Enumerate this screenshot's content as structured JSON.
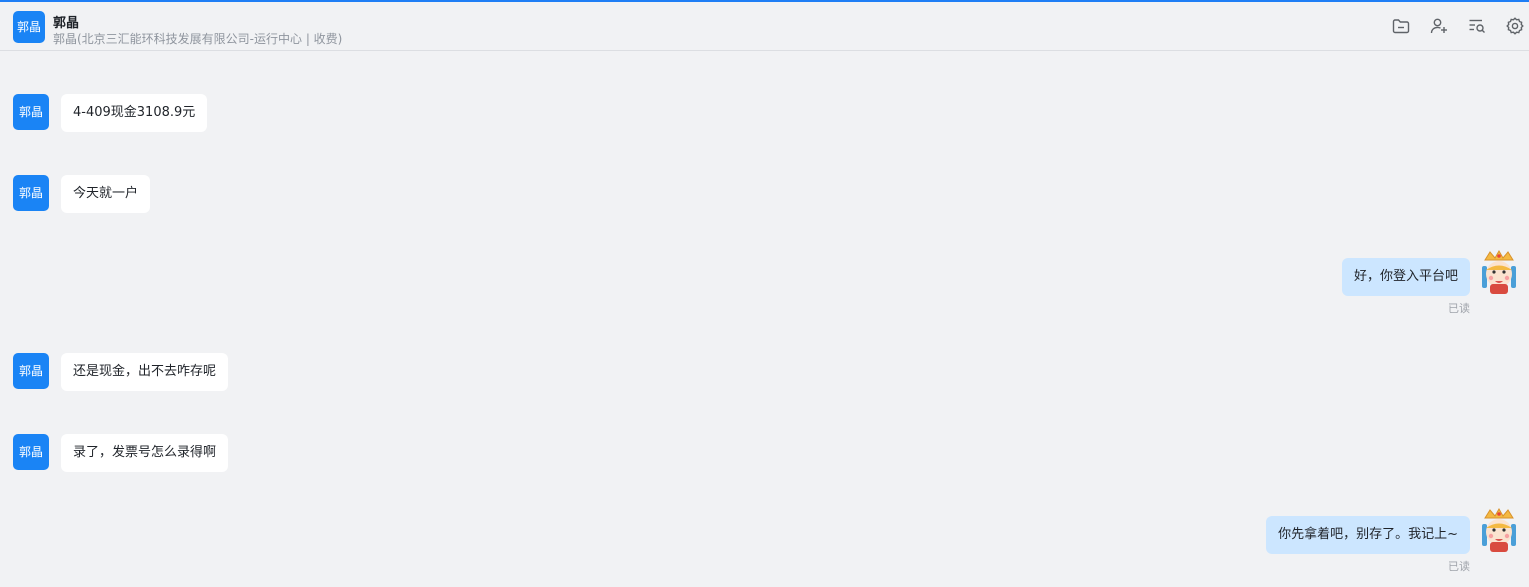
{
  "header": {
    "avatar_text": "郭晶",
    "name": "郭晶",
    "subtitle": "郭晶(北京三汇能环科技发展有限公司-运行中心 | 收费)",
    "tools": [
      "folder-icon",
      "add-user-icon",
      "search-list-icon",
      "gear-icon"
    ]
  },
  "colors": {
    "accent": "#1f7ef5",
    "avatar_bg": "#1a84f5",
    "incoming_bubble": "#ffffff",
    "outgoing_bubble": "#cce6ff",
    "background": "#f1f2f4"
  },
  "messages": [
    {
      "side": "left",
      "avatar_text": "郭晶",
      "text": "4-409现金3108.9元"
    },
    {
      "side": "left",
      "avatar_text": "郭晶",
      "text": "今天就一户"
    },
    {
      "side": "right",
      "text": "好，你登入平台吧",
      "status": "已读"
    },
    {
      "side": "left",
      "avatar_text": "郭晶",
      "text": "还是现金，出不去咋存呢"
    },
    {
      "side": "left",
      "avatar_text": "郭晶",
      "text": "录了，发票号怎么录得啊"
    },
    {
      "side": "right",
      "text": "你先拿着吧，别存了。我记上~",
      "status": "已读"
    }
  ]
}
